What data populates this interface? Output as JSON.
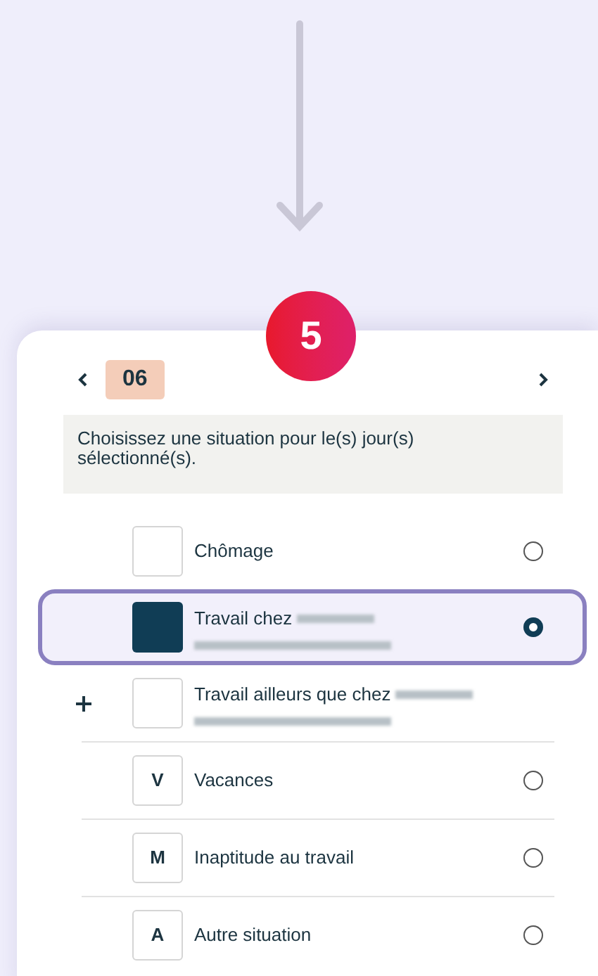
{
  "step_badge": "5",
  "date_nav": {
    "day": "06"
  },
  "instruction": "Choisissez une situation pour le(s) jour(s) sélectionné(s).",
  "options": [
    {
      "kind": "situation",
      "label": "Chômage",
      "selected": false,
      "redacted": false
    },
    {
      "kind": "situation",
      "label": "Travail chez",
      "selected": true,
      "redacted": true
    },
    {
      "kind": "add",
      "label": "Travail ailleurs que chez",
      "selected": false,
      "redacted": true
    },
    {
      "kind": "situation",
      "code": "V",
      "label": "Vacances",
      "selected": false,
      "redacted": false
    },
    {
      "kind": "situation",
      "code": "M",
      "label": "Inaptitude au travail",
      "selected": false,
      "redacted": false
    },
    {
      "kind": "situation",
      "code": "A",
      "label": "Autre situation",
      "selected": false,
      "redacted": false
    }
  ]
}
